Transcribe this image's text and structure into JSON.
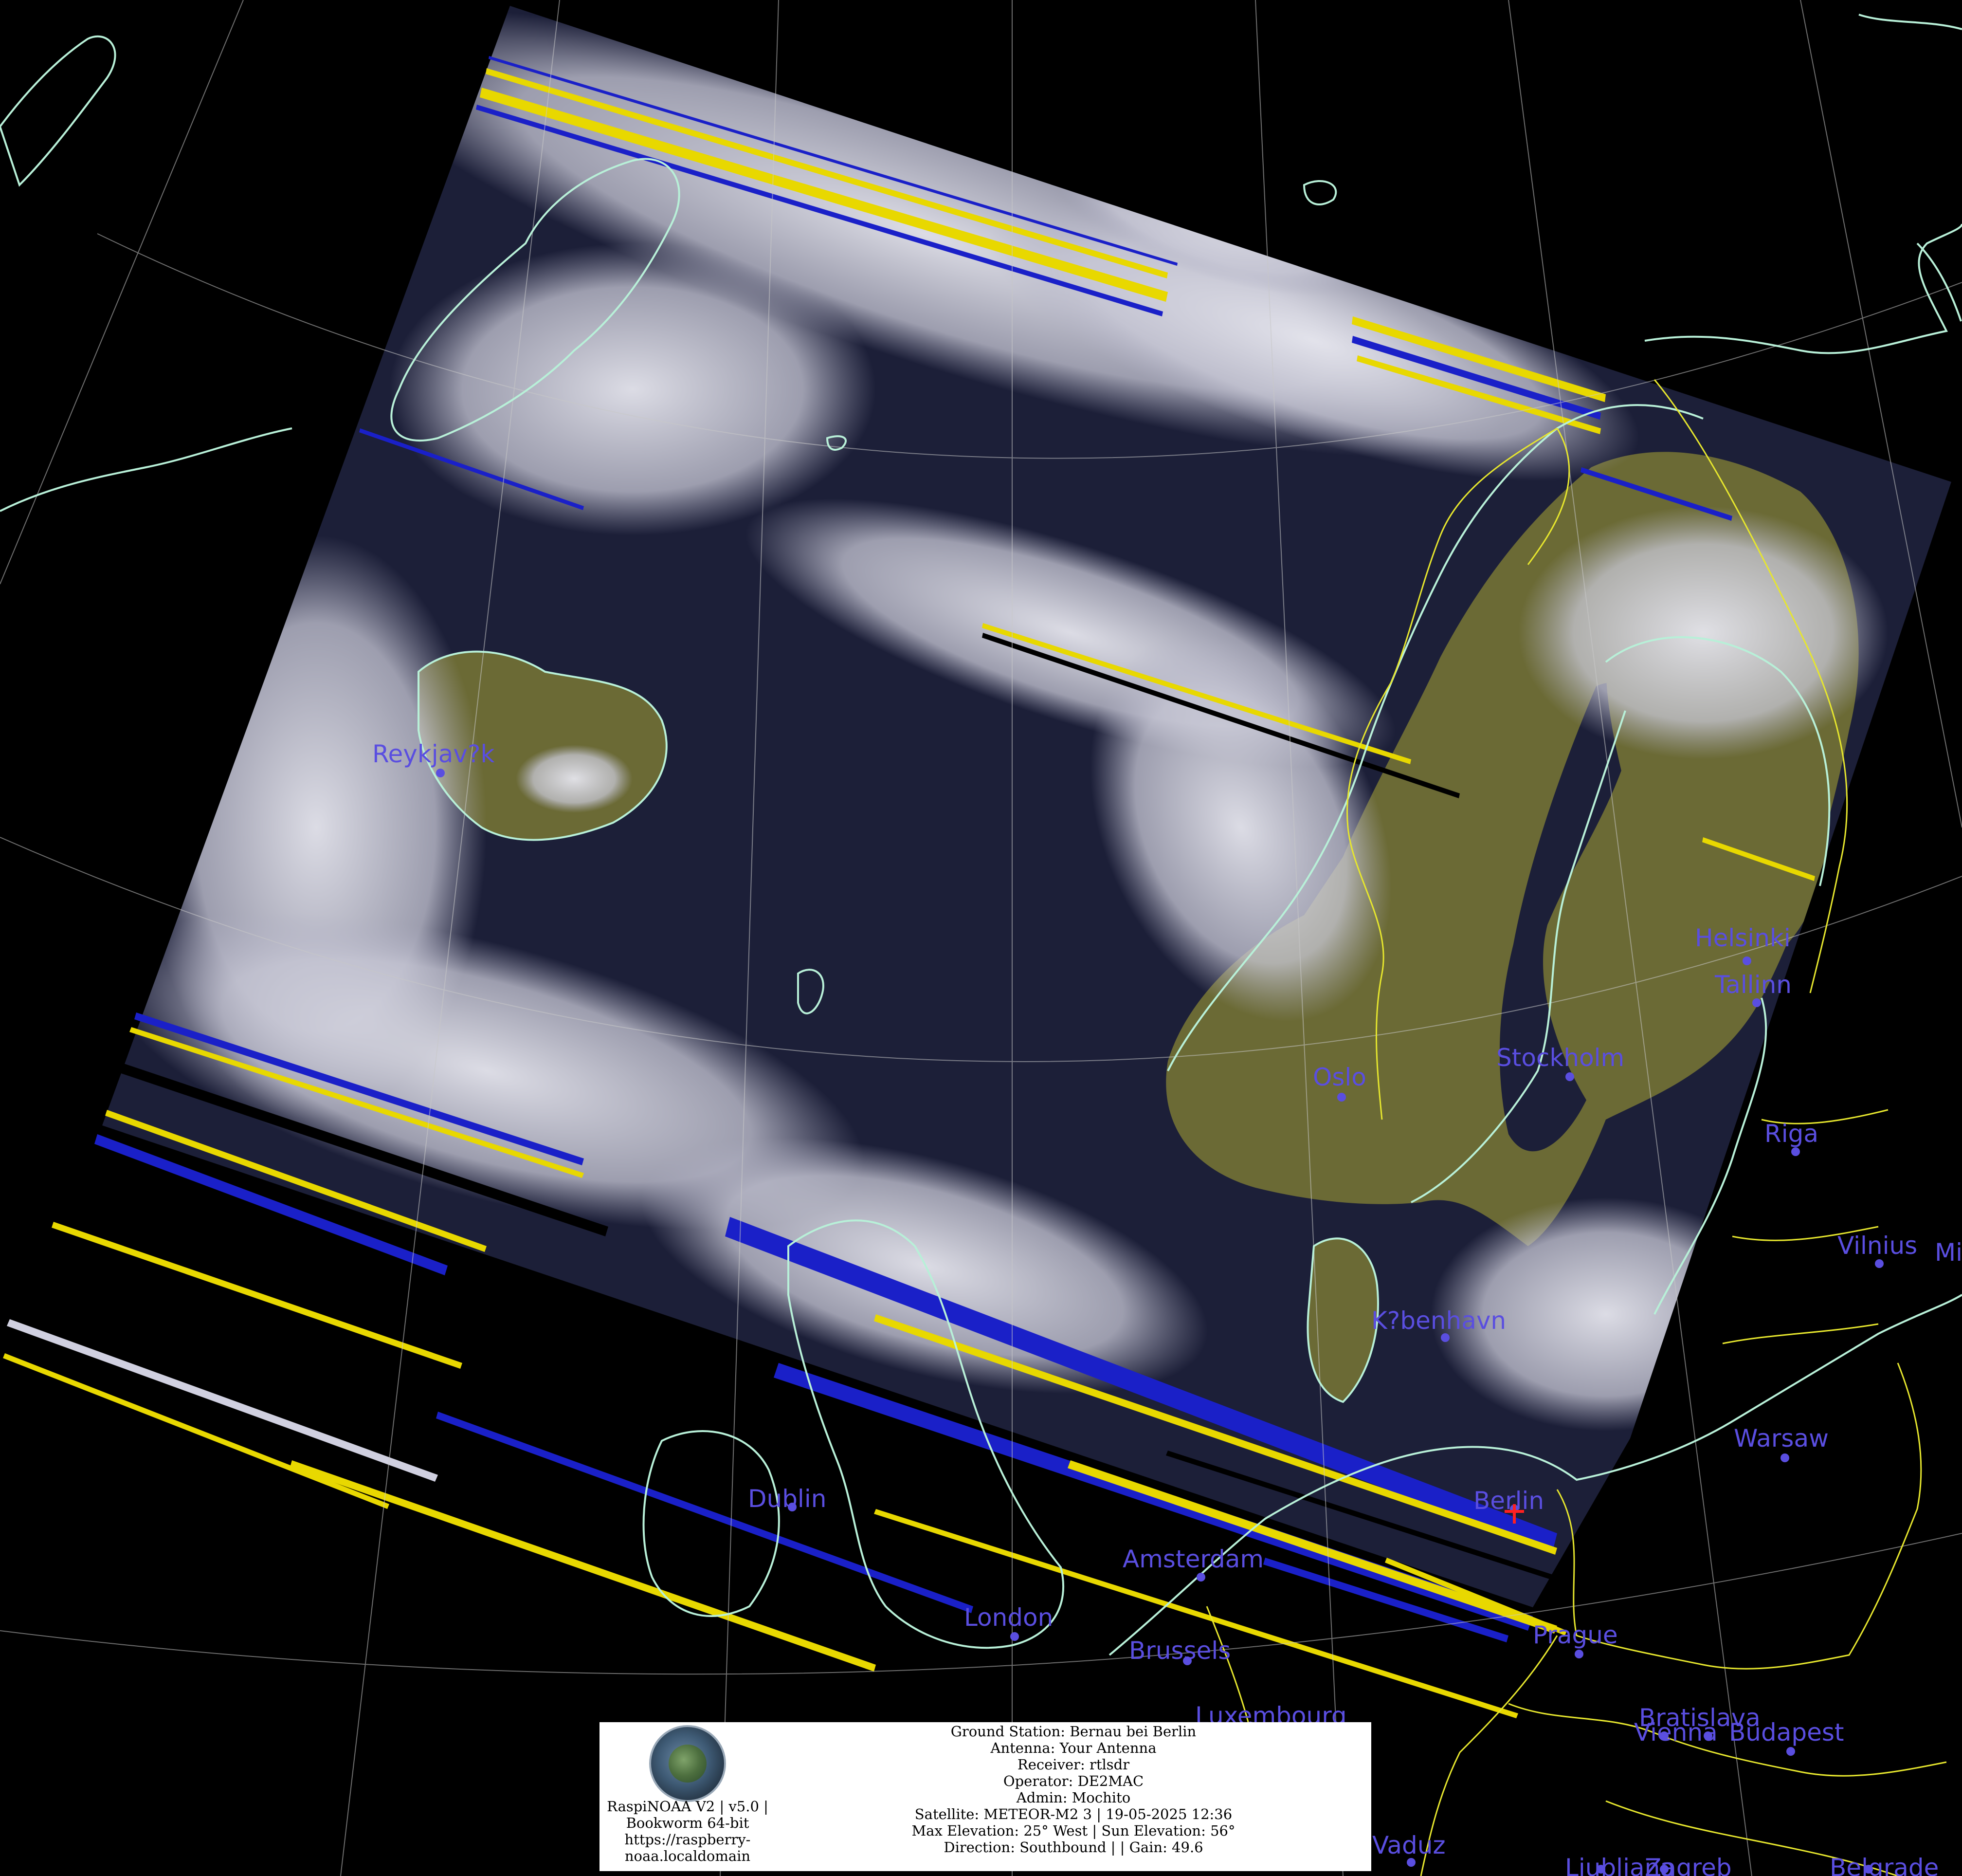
{
  "map": {
    "cities": [
      {
        "name": "Reykjav?k"
      },
      {
        "name": "Helsinki"
      },
      {
        "name": "Tallinn"
      },
      {
        "name": "Stockholm"
      },
      {
        "name": "Oslo"
      },
      {
        "name": "Riga"
      },
      {
        "name": "Vilnius"
      },
      {
        "name": "Mi"
      },
      {
        "name": "K?benhavn"
      },
      {
        "name": "Warsaw"
      },
      {
        "name": "Berlin"
      },
      {
        "name": "Dublin"
      },
      {
        "name": "Amsterdam"
      },
      {
        "name": "London"
      },
      {
        "name": "Brussels"
      },
      {
        "name": "Prague"
      },
      {
        "name": "Luxembourg"
      },
      {
        "name": "Bratislava"
      },
      {
        "name": "Vienna"
      },
      {
        "name": "Budapest"
      },
      {
        "name": "Vaduz"
      },
      {
        "name": "Ljubljana"
      },
      {
        "name": "Zagreb"
      },
      {
        "name": "Belgrade"
      }
    ],
    "colors": {
      "background": "#000000",
      "coastline": "#b8f0d8",
      "border": "#e6e62e",
      "graticule": "#c8c8c8",
      "label": "#5a4ee0",
      "cloud": "#dcdce4",
      "sea": "#1c1f38",
      "land": "#6b6a35",
      "noise_yellow": "#e8d800",
      "noise_blue": "#1a20c8",
      "station_marker": "#ff2020"
    }
  },
  "info": {
    "logo_icon": "raspinoaa-logo-icon",
    "left_lines": [
      "RaspiNOAA V2 | v5.0 |",
      "Bookworm 64-bit",
      "https://raspberry-",
      "noaa.localdomain"
    ],
    "right_lines": [
      "Ground Station: Bernau bei Berlin",
      "Antenna: Your Antenna",
      "Receiver: rtlsdr",
      "Operator: DE2MAC",
      "Admin: Mochito",
      "Satellite: METEOR-M2 3 | 19-05-2025 12:36",
      "Max Elevation: 25° West | Sun Elevation: 56°",
      "Direction: Southbound | | Gain: 49.6"
    ]
  }
}
